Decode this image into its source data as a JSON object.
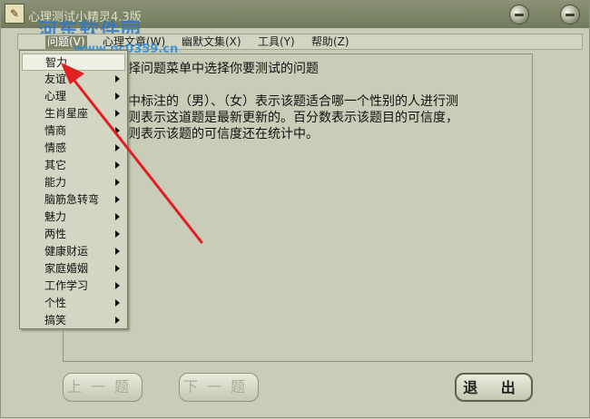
{
  "window": {
    "title": "心理测试小精灵4.3版",
    "icon": "app-icon",
    "watermark": "河东软件园",
    "watermark_url": "www.pc0359.cn"
  },
  "menubar": {
    "items": [
      {
        "label": "问题(V)",
        "active": true
      },
      {
        "label": "心理文章(W)",
        "active": false
      },
      {
        "label": "幽默文集(X)",
        "active": false
      },
      {
        "label": "工具(Y)",
        "active": false
      },
      {
        "label": "帮助(Z)",
        "active": false
      }
    ]
  },
  "dropdown": {
    "items": [
      {
        "label": "智力",
        "has_submenu": false,
        "highlighted": true
      },
      {
        "label": "友谊",
        "has_submenu": true
      },
      {
        "label": "心理",
        "has_submenu": true
      },
      {
        "label": "生肖星座",
        "has_submenu": true
      },
      {
        "label": "情商",
        "has_submenu": true
      },
      {
        "label": "情感",
        "has_submenu": true
      },
      {
        "label": "其它",
        "has_submenu": true
      },
      {
        "label": "能力",
        "has_submenu": true
      },
      {
        "label": "脑筋急转弯",
        "has_submenu": true
      },
      {
        "label": "魅力",
        "has_submenu": true
      },
      {
        "label": "两性",
        "has_submenu": true
      },
      {
        "label": "健康财运",
        "has_submenu": true
      },
      {
        "label": "家庭婚姻",
        "has_submenu": true
      },
      {
        "label": "工作学习",
        "has_submenu": true
      },
      {
        "label": "个性",
        "has_submenu": true
      },
      {
        "label": "搞笑",
        "has_submenu": true
      }
    ]
  },
  "content": {
    "lines": [
      "择问题菜单中选择你要测试的问题",
      "",
      "中标注的（男）、（女）表示该题适合哪一个性别的人进行测",
      "则表示这道题是最新更新的。百分数表示该题目的可信度，",
      "则表示该题的可信度还在统计中。"
    ]
  },
  "buttons": {
    "prev": "上一题",
    "next": "下一题",
    "exit": "退 出"
  },
  "colors": {
    "window_bg": "#c9cdb7",
    "titlebar": "#7d8468",
    "annotation_arrow": "#e02020"
  }
}
